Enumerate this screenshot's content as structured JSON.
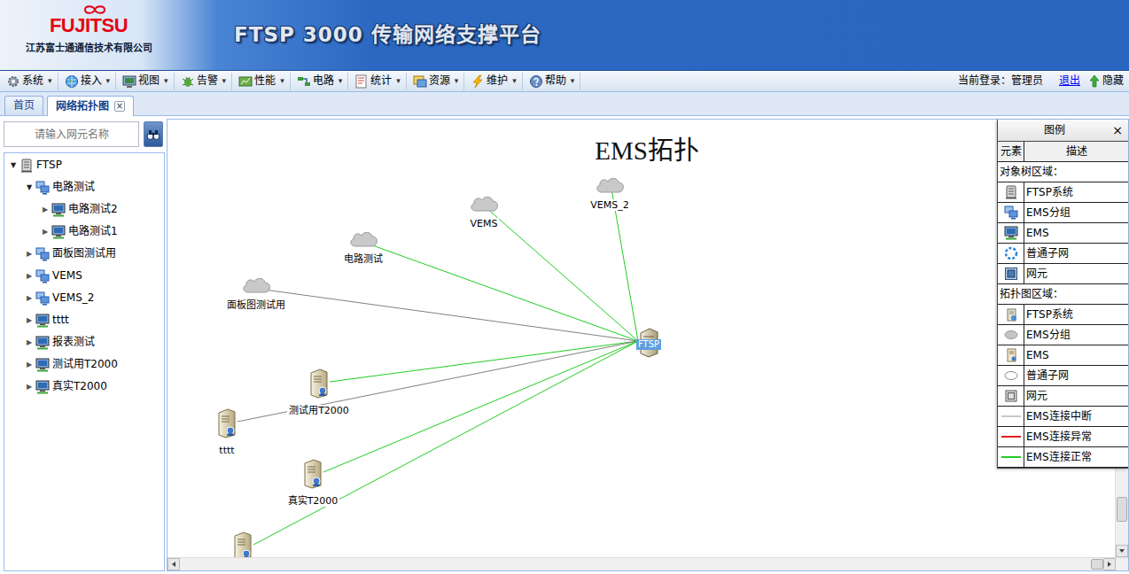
{
  "header": {
    "logo": "FUJITSU",
    "company": "江苏富士通通信技术有限公司",
    "title": "FTSP 3000 传输网络支撑平台"
  },
  "menu": [
    {
      "label": "系统",
      "caret": "▾"
    },
    {
      "label": "接入",
      "caret": "▾"
    },
    {
      "label": "视图",
      "caret": "▾"
    },
    {
      "label": "告警",
      "caret": "▾"
    },
    {
      "label": "性能",
      "caret": "▾"
    },
    {
      "label": "电路",
      "caret": "▾"
    },
    {
      "label": "统计",
      "caret": "▾"
    },
    {
      "label": "资源",
      "caret": "▾"
    },
    {
      "label": "维护",
      "caret": "▾"
    },
    {
      "label": "帮助",
      "caret": "▾"
    }
  ],
  "user": {
    "login": "当前登录：管理员",
    "logout": "退出",
    "hide": "隐藏"
  },
  "tabs": [
    {
      "label": "首页",
      "selected": false
    },
    {
      "label": "网络拓扑图",
      "selected": true,
      "close": "×"
    }
  ],
  "search": {
    "placeholder": "请输入网元名称"
  },
  "tree": [
    {
      "label": "FTSP",
      "kind": "system",
      "expanded": true,
      "toggle": "▼",
      "children": [
        {
          "label": "电路测试",
          "kind": "group",
          "expanded": true,
          "toggle": "▼",
          "children": [
            {
              "label": "电路测试2",
              "kind": "ems",
              "expanded": false,
              "toggle": "▶"
            },
            {
              "label": "电路测试1",
              "kind": "ems",
              "expanded": false,
              "toggle": "▶"
            }
          ]
        },
        {
          "label": "面板图测试用",
          "kind": "group",
          "expanded": false,
          "toggle": "▶"
        },
        {
          "label": "VEMS",
          "kind": "group",
          "expanded": false,
          "toggle": "▶"
        },
        {
          "label": "VEMS_2",
          "kind": "group",
          "expanded": false,
          "toggle": "▶"
        },
        {
          "label": "tttt",
          "kind": "ems",
          "expanded": false,
          "toggle": "▶"
        },
        {
          "label": "报表测试",
          "kind": "ems",
          "expanded": false,
          "toggle": "▶"
        },
        {
          "label": "测试用T2000",
          "kind": "ems",
          "expanded": false,
          "toggle": "▶"
        },
        {
          "label": "真实T2000",
          "kind": "ems",
          "expanded": false,
          "toggle": "▶"
        }
      ]
    }
  ],
  "diagram": {
    "title": "EMS拓扑",
    "nodes": [
      {
        "label": "VEMS_2",
        "kind": "group",
        "selected": false,
        "color": "#22cc22"
      },
      {
        "label": "VEMS",
        "kind": "group",
        "selected": false,
        "color": "#22cc22"
      },
      {
        "label": "电路测试",
        "kind": "group",
        "selected": false,
        "color": "#22cc22"
      },
      {
        "label": "面板图测试用",
        "kind": "group",
        "selected": false,
        "color": "#808080"
      },
      {
        "label": "FTSP",
        "kind": "system",
        "selected": true
      },
      {
        "label": "测试用T2000",
        "kind": "ems",
        "selected": false,
        "color": "#22cc22"
      },
      {
        "label": "tttt",
        "kind": "ems",
        "selected": false,
        "color": "#808080"
      },
      {
        "label": "真实T2000",
        "kind": "ems",
        "selected": false,
        "color": "#22cc22"
      },
      {
        "kind": "ems",
        "selected": false,
        "color": "#22cc22"
      }
    ]
  },
  "legend": {
    "title": "图例",
    "close": "×",
    "columns": [
      "元素",
      "描述"
    ],
    "sections": [
      {
        "title": "对象树区域：",
        "rows": [
          {
            "kind": "system",
            "label": "FTSP系统"
          },
          {
            "kind": "group",
            "label": "EMS分组"
          },
          {
            "kind": "ems",
            "label": "EMS"
          },
          {
            "kind": "subnet",
            "label": "普通子网"
          },
          {
            "kind": "ne",
            "label": "网元"
          }
        ]
      },
      {
        "title": "拓扑图区域：",
        "rows": [
          {
            "kind": "system",
            "label": "FTSP系统"
          },
          {
            "kind": "group",
            "label": "EMS分组"
          },
          {
            "kind": "ems",
            "label": "EMS"
          },
          {
            "kind": "subnet",
            "label": "普通子网"
          },
          {
            "kind": "ne",
            "label": "网元"
          },
          {
            "kind": "line",
            "label": "EMS连接中断",
            "color": "#c8c8c8"
          },
          {
            "kind": "line",
            "label": "EMS连接异常",
            "color": "#e02020"
          },
          {
            "kind": "line",
            "label": "EMS连接正常",
            "color": "#22cc22"
          }
        ]
      }
    ]
  },
  "scrollbars": {
    "vertical": {
      "level": 0.94
    },
    "horizontal": {
      "level": 1
    }
  }
}
